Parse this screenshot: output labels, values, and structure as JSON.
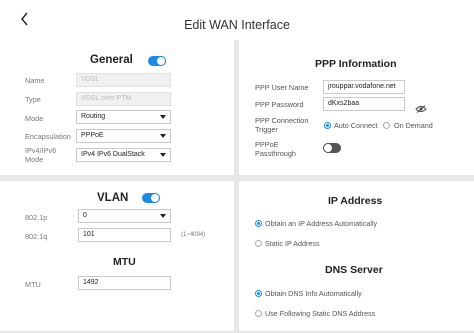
{
  "header": {
    "title": "Edit WAN Interface"
  },
  "general": {
    "title": "General",
    "name": {
      "label": "Name",
      "value": "VDSL"
    },
    "type": {
      "label": "Type",
      "value": "VDSL over PTM"
    },
    "mode": {
      "label": "Mode",
      "value": "Routing"
    },
    "encapsulation": {
      "label": "Encapsulation",
      "value": "PPPoE"
    },
    "ip_mode": {
      "label_line1": "IPv4/IPv6",
      "label_line2": "Mode",
      "value": "IPv4 IPv6 DualStack"
    }
  },
  "vlan": {
    "title": "VLAN",
    "p8021p": {
      "label": "802.1p",
      "value": "0"
    },
    "p8021q": {
      "label": "802.1q",
      "value": "101",
      "hint": "(1~4094)"
    }
  },
  "mtu": {
    "title": "MTU",
    "label": "MTU",
    "value": "1492"
  },
  "ppp": {
    "title": "PPP Information",
    "user": {
      "label": "PPP User Name",
      "value": "jrouppar.vodafone.net"
    },
    "password": {
      "label": "PPP Password",
      "value": "dKxs2baa"
    },
    "trigger": {
      "label_line1": "PPP Connection",
      "label_line2": "Trigger",
      "options": [
        "Auto Connect",
        "On Demand"
      ],
      "selected": "Auto Connect"
    },
    "passthrough": {
      "label_line1": "PPPoE",
      "label_line2": "Passthrough"
    }
  },
  "ip_address": {
    "title": "IP Address",
    "options": [
      "Obtain an IP Address Automatically",
      "Static IP Address"
    ],
    "selected": "Obtain an IP Address Automatically"
  },
  "dns": {
    "title": "DNS Server",
    "options": [
      "Obtain DNS Info Automatically",
      "Use Following Static DNS Address"
    ],
    "selected": "Obtain DNS Info Automatically"
  },
  "icons": [
    "back-arrow-icon",
    "eye-off-icon"
  ],
  "colors": {
    "accent": "#1e88e5",
    "toggle_off": "#555555",
    "background": "#e7e7e7"
  }
}
